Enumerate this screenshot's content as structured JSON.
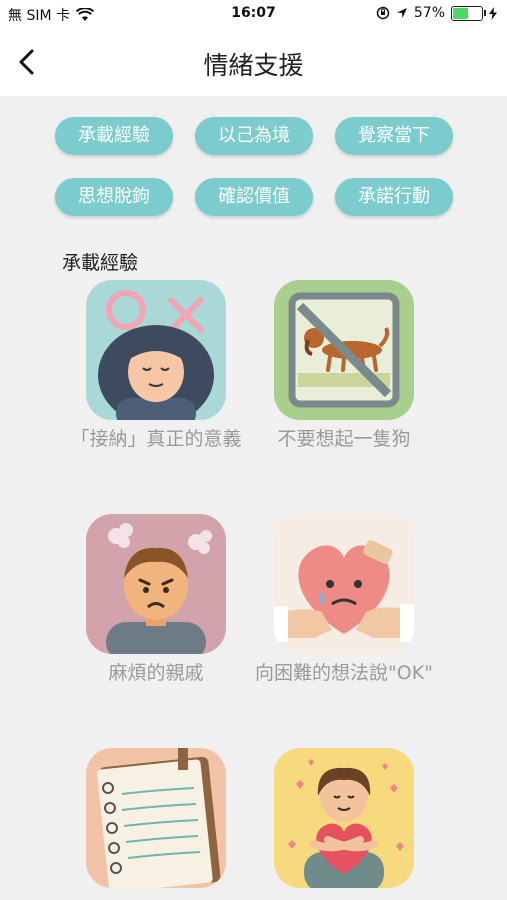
{
  "status": {
    "carrier": "無 SIM 卡",
    "time": "16:07",
    "battery_percent": "57%",
    "battery_level": 0.57
  },
  "header": {
    "title": "情緒支援"
  },
  "chips": [
    "承載經驗",
    "以己為境",
    "覺察當下",
    "思想脫鉤",
    "確認價值",
    "承諾行動"
  ],
  "section": {
    "title": "承載經驗"
  },
  "cards": [
    {
      "caption": "「接納」真正的意義"
    },
    {
      "caption": "不要想起一隻狗"
    },
    {
      "caption": "麻煩的親戚"
    },
    {
      "caption": "向困難的想法說\"OK\""
    },
    {
      "caption": ""
    },
    {
      "caption": ""
    }
  ],
  "colors": {
    "accent": "#7ccccd",
    "background": "#f0f0f0",
    "caption": "#9a9a9a"
  }
}
